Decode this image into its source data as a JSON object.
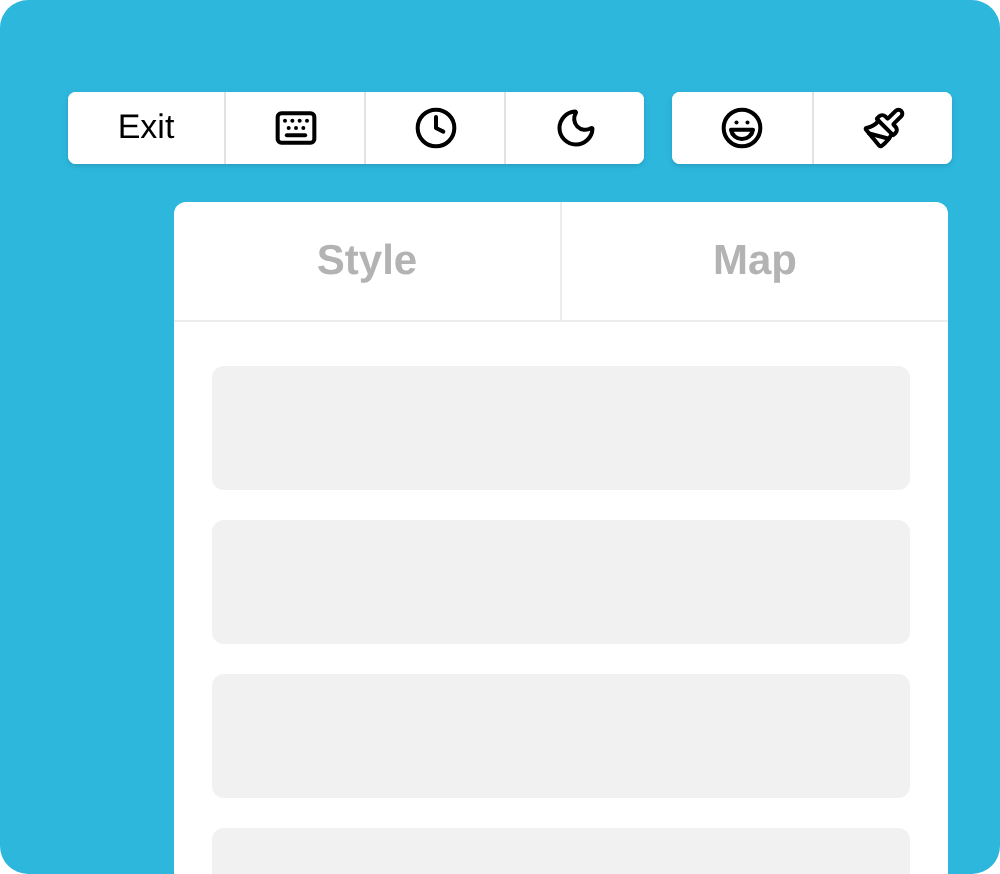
{
  "toolbar": {
    "groups": [
      {
        "buttons": [
          {
            "kind": "text",
            "label": "Exit"
          },
          {
            "kind": "icon"
          },
          {
            "kind": "icon"
          },
          {
            "kind": "icon"
          }
        ]
      },
      {
        "buttons": [
          {
            "kind": "icon"
          },
          {
            "kind": "icon"
          }
        ]
      }
    ]
  },
  "panel": {
    "tabs": [
      {
        "label": "Style",
        "selected": false
      },
      {
        "label": "Map",
        "selected": false
      }
    ],
    "items": [
      {
        "kind": "placeholder"
      },
      {
        "kind": "placeholder"
      },
      {
        "kind": "placeholder"
      },
      {
        "kind": "placeholder"
      }
    ]
  }
}
